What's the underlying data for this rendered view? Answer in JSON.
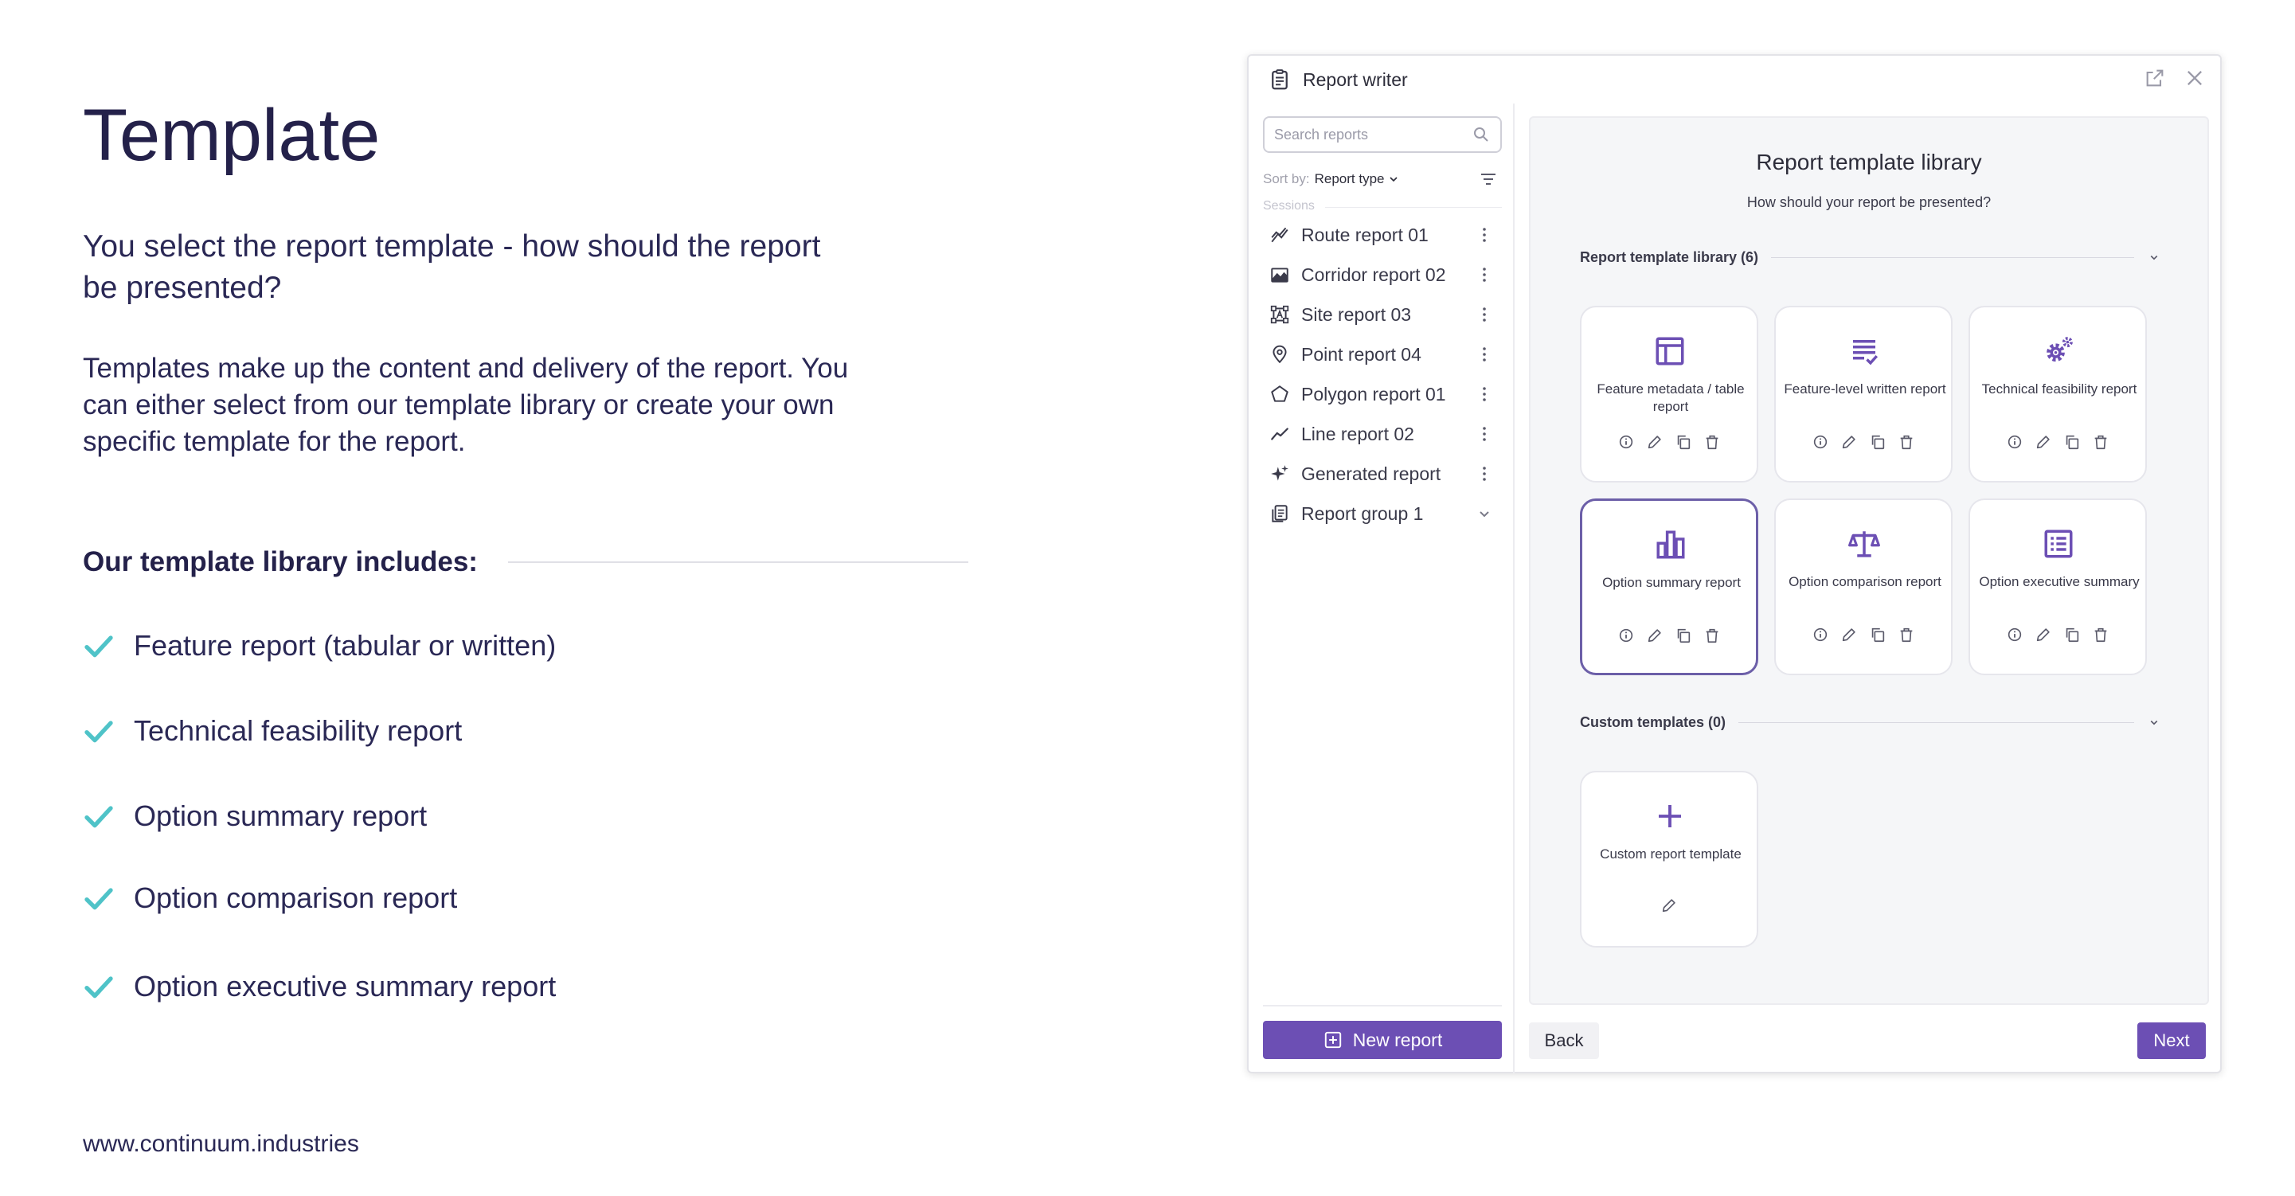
{
  "slide": {
    "title": "Template",
    "intro": "You select the report template - how should the report be presented?",
    "description": "Templates make up the content and delivery of the report. You can either select from our template library or create your own specific template for the report.",
    "library_heading": "Our template library includes:",
    "checklist": [
      "Feature report (tabular or written)",
      "Technical feasibility report",
      "Option summary report",
      "Option comparison report",
      "Option executive summary report"
    ],
    "website": "www.continuum.industries",
    "check_color": "#4fc3c8"
  },
  "app": {
    "window_title": "Report writer",
    "title_icon": "clipboard-icon",
    "search": {
      "placeholder": "Search reports",
      "value": ""
    },
    "sort": {
      "label": "Sort by:",
      "value": "Report type"
    },
    "sessions_label": "Sessions",
    "nav_items": [
      {
        "label": "Route report 01",
        "icon": "route-icon"
      },
      {
        "label": "Corridor report 02",
        "icon": "corridor-icon"
      },
      {
        "label": "Site report 03",
        "icon": "site-icon"
      },
      {
        "label": "Point report 04",
        "icon": "pin-icon"
      },
      {
        "label": "Polygon report 01",
        "icon": "polygon-icon"
      },
      {
        "label": "Line report 02",
        "icon": "line-icon"
      },
      {
        "label": "Generated report",
        "icon": "sparkle-icon"
      },
      {
        "label": "Report group 1",
        "icon": "report-group-icon"
      }
    ],
    "new_report_label": "New report",
    "panel": {
      "title": "Report template library",
      "subtitle": "How should your report be presented?",
      "library_section": "Report template library (6)",
      "custom_section": "Custom templates (0)",
      "templates": [
        {
          "label": "Feature metadata / table report",
          "icon": "table-icon",
          "selected": false
        },
        {
          "label": "Feature-level written report",
          "icon": "written-report-icon",
          "selected": false
        },
        {
          "label": "Technical feasibility report",
          "icon": "gears-icon",
          "selected": false
        },
        {
          "label": "Option summary report",
          "icon": "bar-chart-icon",
          "selected": true
        },
        {
          "label": "Option comparison report",
          "icon": "scales-icon",
          "selected": false
        },
        {
          "label": "Option executive summary",
          "icon": "list-icon",
          "selected": false
        }
      ],
      "custom_template": {
        "label": "Custom report template",
        "icon": "plus-icon"
      }
    },
    "back_label": "Back",
    "next_label": "Next",
    "accent_color": "#6c4fb4"
  }
}
